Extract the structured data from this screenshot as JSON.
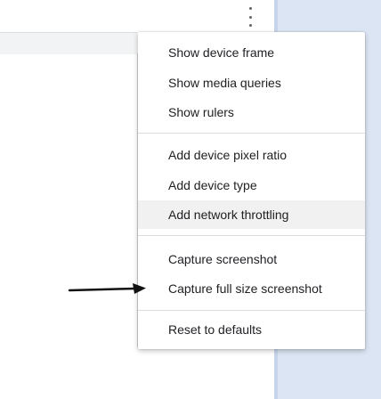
{
  "menu": {
    "groups": [
      [
        "Show device frame",
        "Show media queries",
        "Show rulers"
      ],
      [
        "Add device pixel ratio",
        "Add device type",
        "Add network throttling"
      ],
      [
        "Capture screenshot",
        "Capture full size screenshot"
      ],
      [
        "Reset to defaults"
      ]
    ],
    "highlighted_item": "Add network throttling"
  },
  "toolbar": {
    "more_icon": "kebab-menu-icon"
  },
  "annotation": {
    "arrow_points_to": "Capture full size screenshot"
  },
  "colors": {
    "menu_bg": "#ffffff",
    "highlight_bg": "#f1f1f1",
    "viewport_edge": "#dbe5f3",
    "text": "#202124"
  }
}
